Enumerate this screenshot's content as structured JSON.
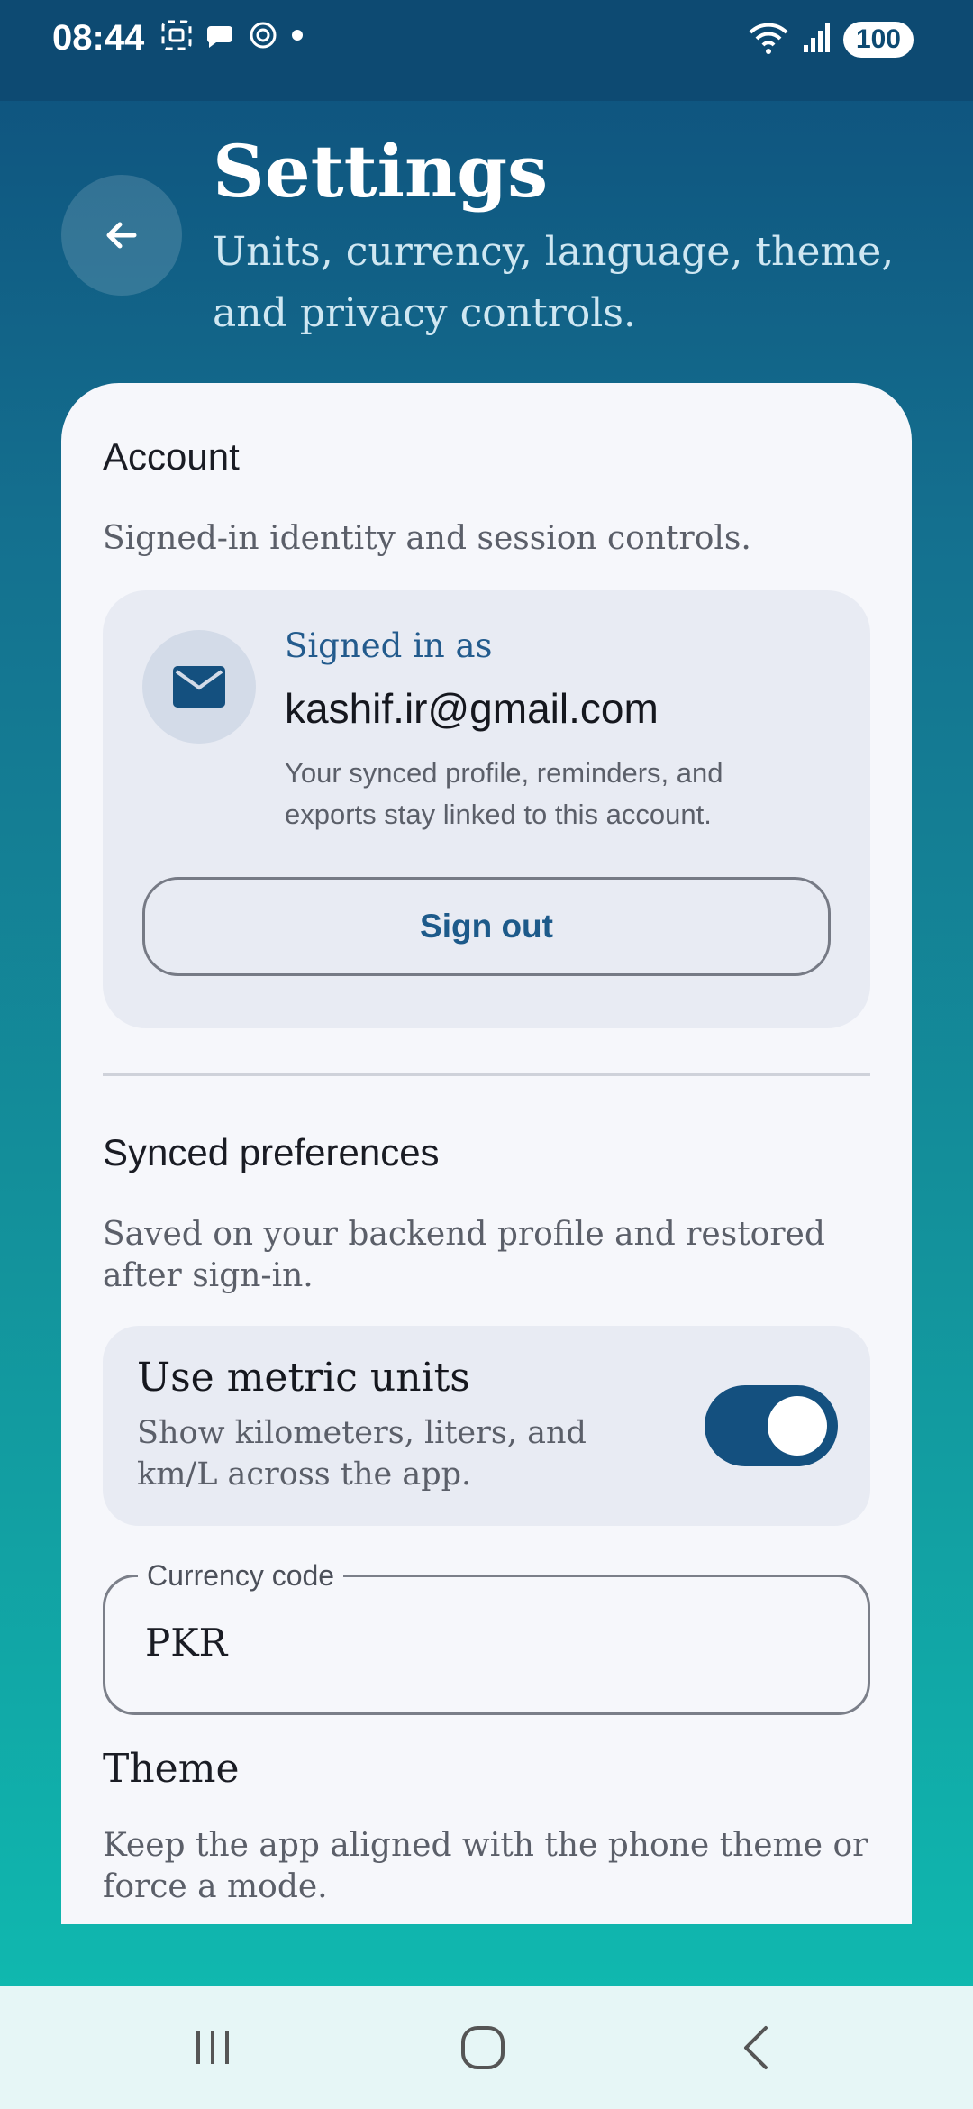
{
  "status_bar": {
    "time": "08:44",
    "battery": "100",
    "left_icons": [
      "screenshot-icon",
      "chat-icon",
      "openai-icon",
      "dot-icon"
    ],
    "right_icons": [
      "wifi-icon",
      "signal-icon"
    ]
  },
  "header": {
    "title": "Settings",
    "subtitle": "Units, currency, language, theme, and privacy controls."
  },
  "account": {
    "title": "Account",
    "description": "Signed-in identity and session controls.",
    "signed_in_label": "Signed in as",
    "email": "kashif.ir@gmail.com",
    "note": "Your synced profile, reminders, and exports stay linked to this account.",
    "sign_out_label": "Sign out"
  },
  "synced": {
    "title": "Synced preferences",
    "description": "Saved on your backend profile and restored after sign-in.",
    "metric": {
      "title": "Use metric units",
      "description": "Show kilometers, liters, and km/L across the app.",
      "enabled": true
    },
    "currency": {
      "label": "Currency code",
      "value": "PKR"
    }
  },
  "theme": {
    "title": "Theme",
    "description": "Keep the app aligned with the phone theme or force a mode."
  },
  "colors": {
    "accent": "#14507f",
    "card": "#f6f7fb",
    "gradient_top": "#0e4f7c",
    "gradient_bottom": "#0fbeb2"
  }
}
